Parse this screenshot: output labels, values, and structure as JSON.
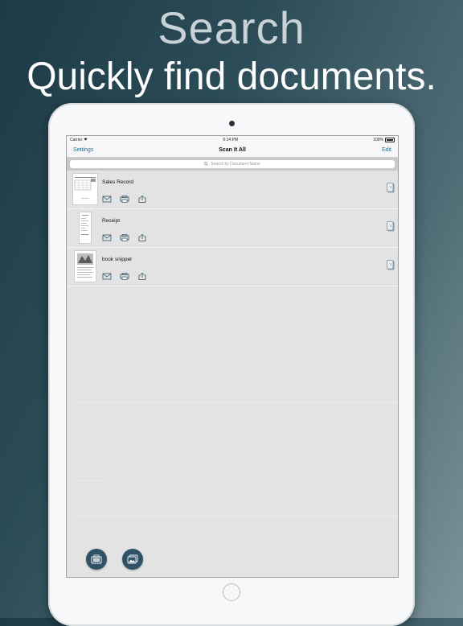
{
  "hero": {
    "title": "Search",
    "subtitle": "Quickly find documents."
  },
  "status_bar": {
    "carrier": "Carrier",
    "time": "6:14 PM",
    "battery": "100%"
  },
  "nav": {
    "left": "Settings",
    "title": "Scan It All",
    "right": "Edit"
  },
  "search": {
    "placeholder": "Search by Document Name"
  },
  "documents": [
    {
      "name": "Sales Record"
    },
    {
      "name": "Receipt"
    },
    {
      "name": "book snippet"
    }
  ],
  "icons": {
    "search": "search-icon",
    "mail": "mail-icon",
    "print": "print-icon",
    "share": "share-icon",
    "detail": "document-detail-icon",
    "scan": "scan-document-icon",
    "photo": "import-photo-icon",
    "wifi": "wifi-icon",
    "battery": "battery-icon"
  },
  "colors": {
    "accent": "#2a6b8f",
    "fab": "#2f5266",
    "list_background": "#e3e3e3"
  }
}
